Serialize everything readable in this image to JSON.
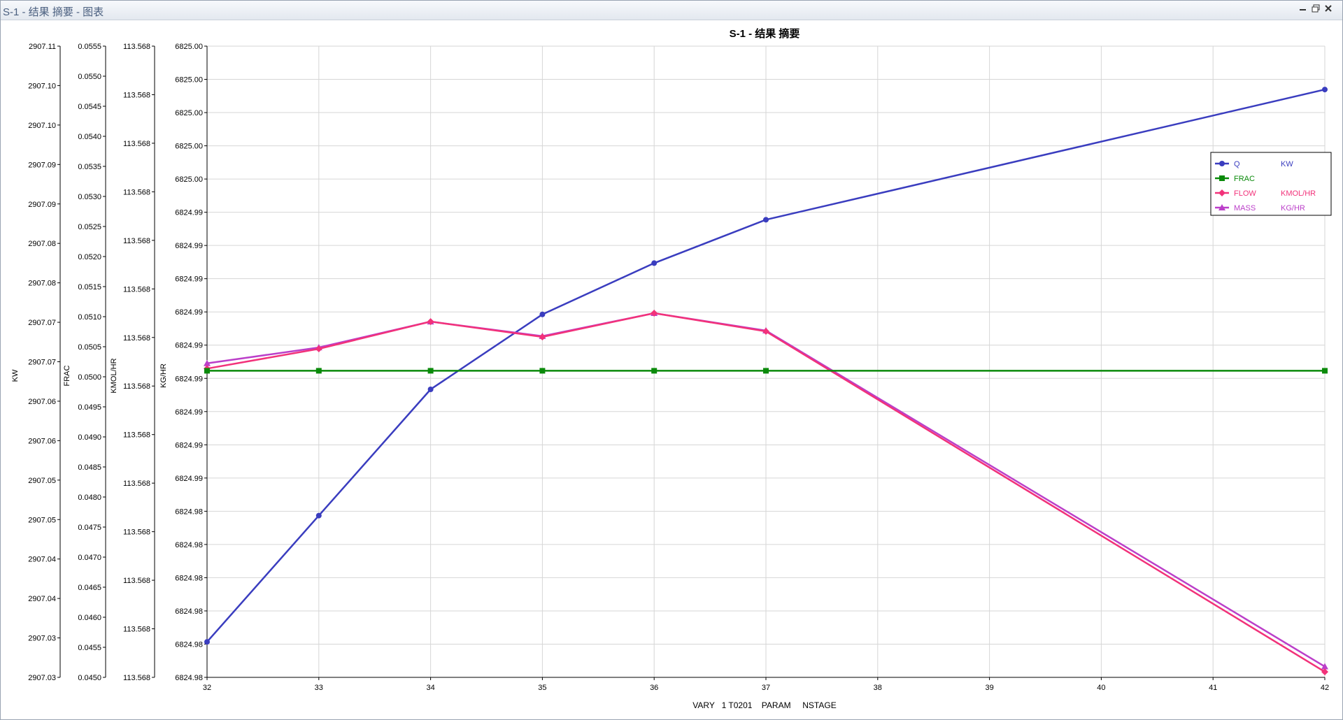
{
  "window": {
    "title": "S-1 - 结果 摘要 - 图表",
    "buttons": [
      "minimize",
      "restore",
      "close"
    ]
  },
  "chart_data": {
    "type": "line",
    "title": "S-1 - 结果 摘要",
    "xlabel": "VARY   1 T0201    PARAM     NSTAGE",
    "x": [
      32,
      33,
      34,
      35,
      36,
      37,
      42
    ],
    "xlim": [
      32,
      42
    ],
    "xticks": [
      "32",
      "33",
      "34",
      "35",
      "36",
      "37",
      "38",
      "39",
      "40",
      "41",
      "42"
    ],
    "grid": true,
    "legend_position": "top-right",
    "axes": [
      {
        "id": "kw",
        "label": "KW",
        "color": "#000000",
        "ticks": [
          "2907.11",
          "2907.10",
          "2907.10",
          "2907.09",
          "2907.09",
          "2907.08",
          "2907.08",
          "2907.07",
          "2907.07",
          "2907.06",
          "2907.06",
          "2907.05",
          "2907.05",
          "2907.04",
          "2907.04",
          "2907.03",
          "2907.03"
        ]
      },
      {
        "id": "frac",
        "label": "FRAC",
        "color": "#000000",
        "ticks": [
          "0.0555",
          "0.0550",
          "0.0545",
          "0.0540",
          "0.0535",
          "0.0530",
          "0.0525",
          "0.0520",
          "0.0515",
          "0.0510",
          "0.0505",
          "0.0500",
          "0.0495",
          "0.0490",
          "0.0485",
          "0.0480",
          "0.0475",
          "0.0470",
          "0.0465",
          "0.0460",
          "0.0455",
          "0.0450"
        ]
      },
      {
        "id": "flow",
        "label": "KMOL/HR",
        "color": "#000000",
        "ticks": [
          "113.568",
          "113.568",
          "113.568",
          "113.568",
          "113.568",
          "113.568",
          "113.568",
          "113.568",
          "113.568",
          "113.568",
          "113.568",
          "113.568",
          "113.568",
          "113.568"
        ]
      },
      {
        "id": "mass",
        "label": "KG/HR",
        "color": "#000000",
        "ticks": [
          "6825.00",
          "6825.00",
          "6825.00",
          "6825.00",
          "6825.00",
          "6824.99",
          "6824.99",
          "6824.99",
          "6824.99",
          "6824.99",
          "6824.99",
          "6824.99",
          "6824.99",
          "6824.99",
          "6824.98",
          "6824.98",
          "6824.98",
          "6824.98",
          "6824.98",
          "6824.98"
        ]
      }
    ],
    "series": [
      {
        "name": "Q",
        "unit": "KW",
        "color": "#3a3dbf",
        "marker": "circle",
        "axis": "kw",
        "values": [
          2907.0345,
          2907.0505,
          2907.0665,
          2907.076,
          2907.0825,
          2907.088,
          2907.1045
        ]
      },
      {
        "name": "FRAC",
        "unit": "",
        "color": "#0a8a0a",
        "marker": "square",
        "axis": "frac",
        "values": [
          0.0501,
          0.0501,
          0.0501,
          0.0501,
          0.0501,
          0.0501,
          0.0501
        ]
      },
      {
        "name": "FLOW",
        "unit": "KMOL/HR",
        "color": "#f2327a",
        "marker": "diamond",
        "axis": "mass",
        "values": [
          6824.98924,
          6824.98999,
          6824.99102,
          6824.99044,
          6824.99134,
          6824.99065,
          6824.97776
        ]
      },
      {
        "name": "MASS",
        "unit": "KG/HR",
        "color": "#bb3fc9",
        "marker": "triangle",
        "axis": "mass",
        "values": [
          6824.98944,
          6824.99004,
          6824.99102,
          6824.99047,
          6824.99134,
          6824.99068,
          6824.97796
        ]
      }
    ],
    "mass_axis_range": [
      6824.97755,
      6825.00145
    ]
  }
}
